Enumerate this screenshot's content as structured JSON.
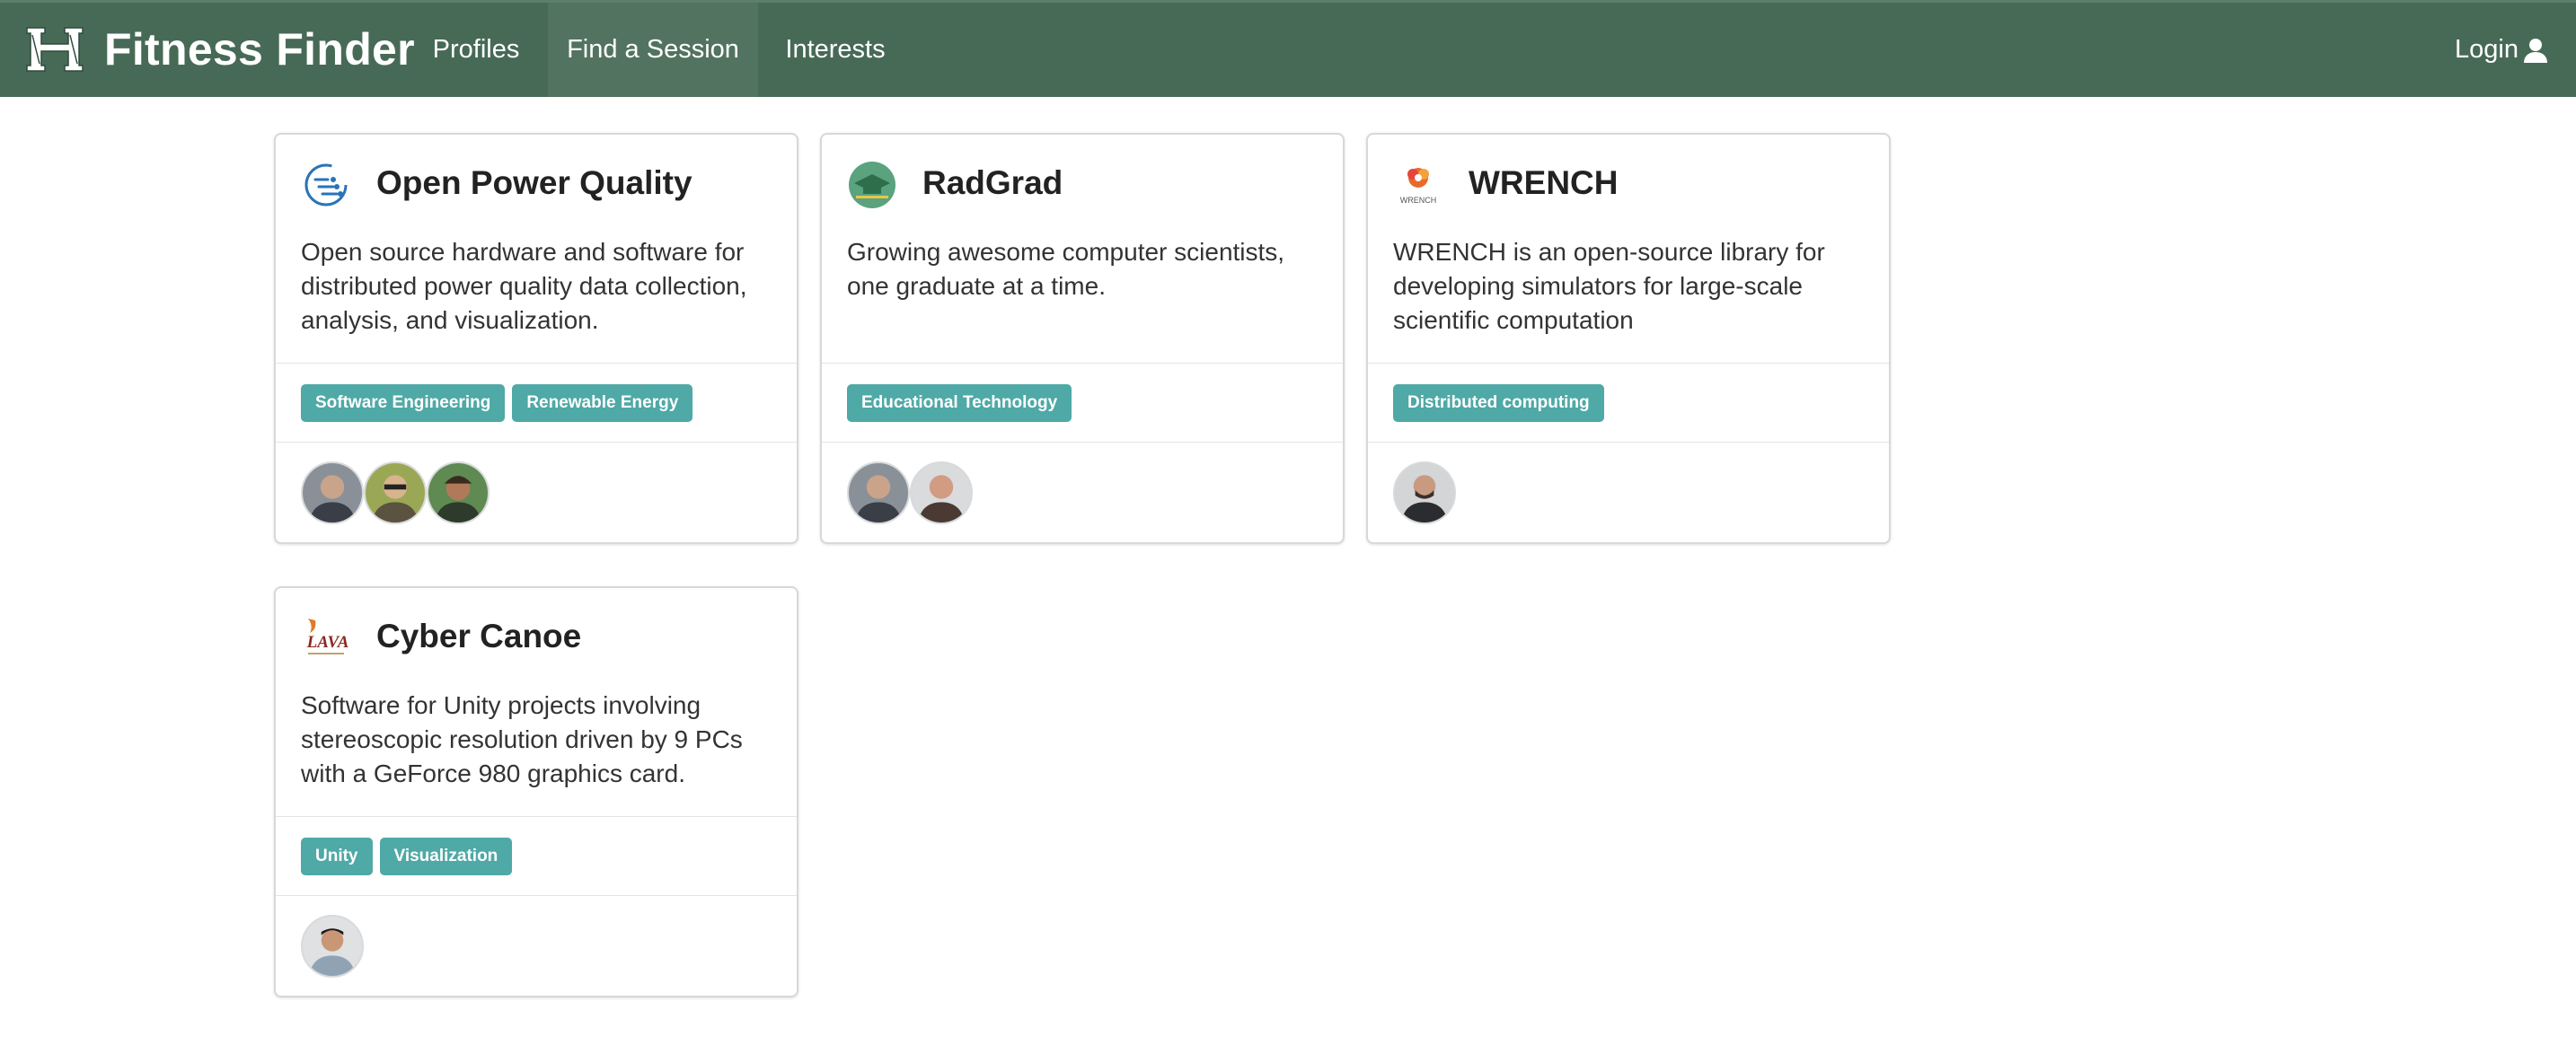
{
  "nav": {
    "brand": "Fitness Finder",
    "items": [
      "Profiles",
      "Find a Session",
      "Interests"
    ],
    "login": "Login",
    "accent": "#476a57",
    "brand_icon": "hawaii-h-logo-icon",
    "login_icon": "user-icon"
  },
  "projects": [
    {
      "title": "Open Power Quality",
      "icon": "opq-logo-icon",
      "description": "Open source hardware and software for distributed power quality data collection, analysis, and visualization.",
      "tags": [
        "Software Engineering",
        "Renewable Energy"
      ]
    },
    {
      "title": "RadGrad",
      "icon": "radgrad-logo-icon",
      "description": "Growing awesome computer scientists, one graduate at a time.",
      "tags": [
        "Educational Technology"
      ]
    },
    {
      "title": "WRENCH",
      "icon": "wrench-logo-icon",
      "description": "WRENCH is an open-source library for developing simulators for large-scale scientific computation",
      "tags": [
        "Distributed computing"
      ]
    },
    {
      "title": "Cyber Canoe",
      "icon": "lava-logo-icon",
      "description": "Software for Unity projects involving stereoscopic resolution driven by 9 PCs with a GeForce 980 graphics card.",
      "tags": [
        "Unity",
        "Visualization"
      ]
    }
  ],
  "tag_color": "#4fa9a6"
}
